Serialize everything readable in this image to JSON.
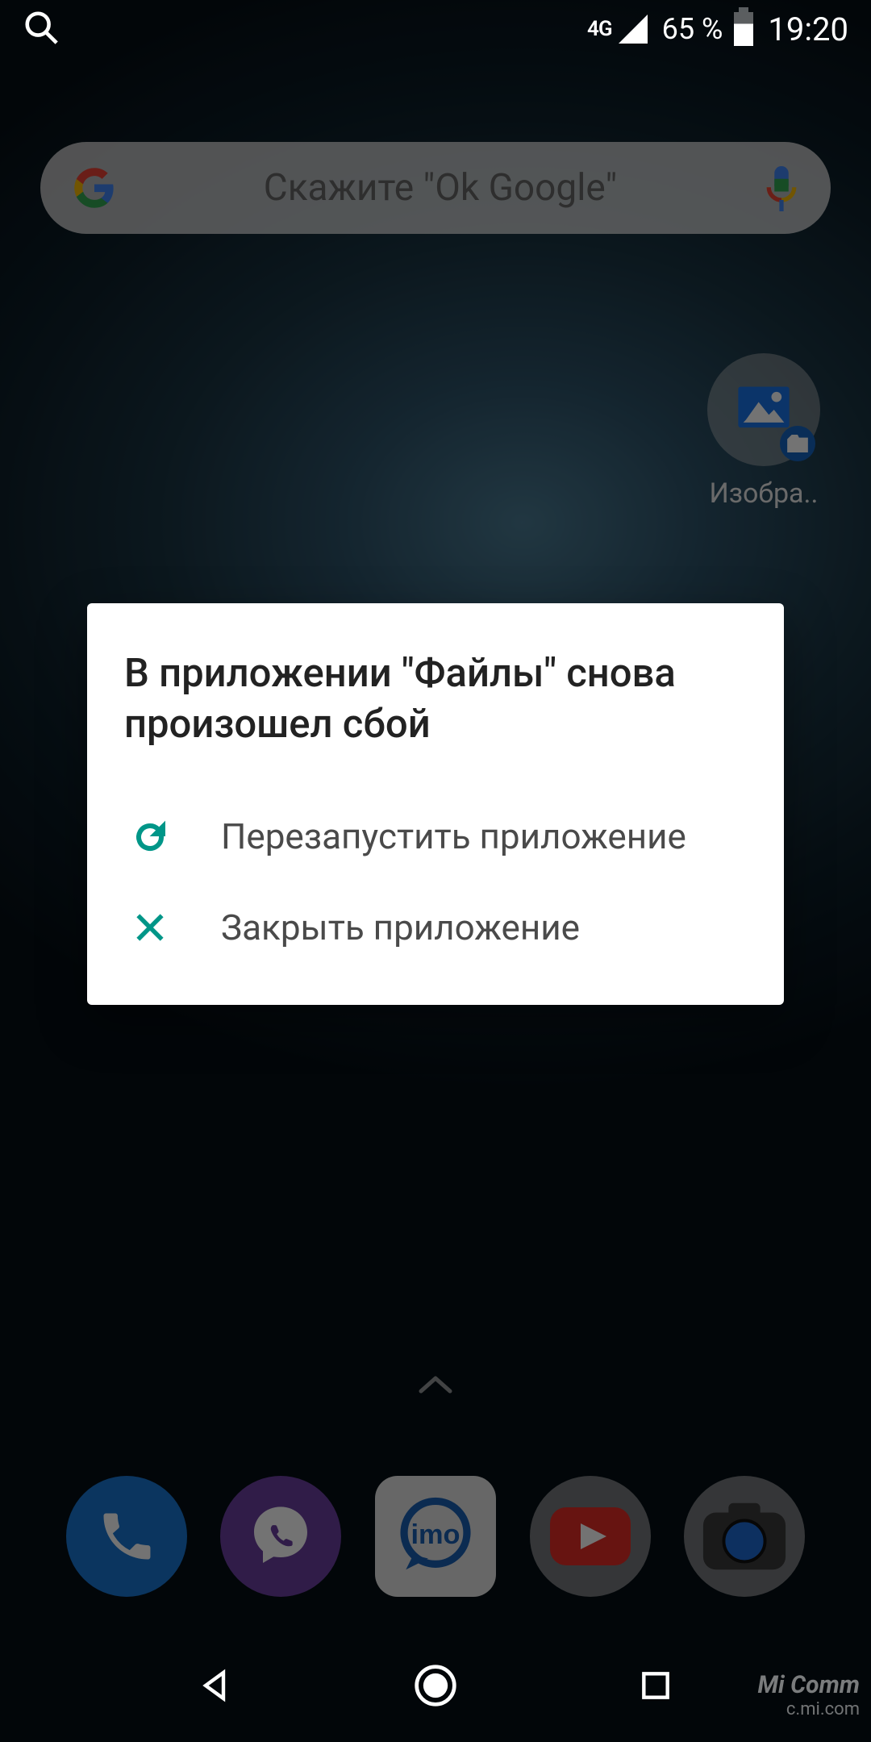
{
  "statusbar": {
    "network_label": "4G",
    "battery_pct": "65 %",
    "time": "19:20"
  },
  "search": {
    "placeholder": "Скажите \"Ok Google\""
  },
  "folder": {
    "label": "Изобра.."
  },
  "dialog": {
    "title": "В приложении \"Файлы\" снова произошел сбой",
    "restart_label": "Перезапустить приложение",
    "close_label": "Закрыть приложение"
  },
  "dock": {
    "apps": [
      "phone",
      "viber",
      "imo",
      "youtube",
      "camera"
    ]
  },
  "watermark": {
    "line1": "Mi Comm",
    "line2": "c.mi.com"
  },
  "colors": {
    "accent_teal": "#009688",
    "phone_blue": "#1976d2",
    "viber_purple": "#6b3fa0",
    "youtube_red": "#e52d27",
    "google_blue": "#4285F4",
    "google_red": "#EA4335",
    "google_yellow": "#FBBC05",
    "google_green": "#34A853"
  }
}
